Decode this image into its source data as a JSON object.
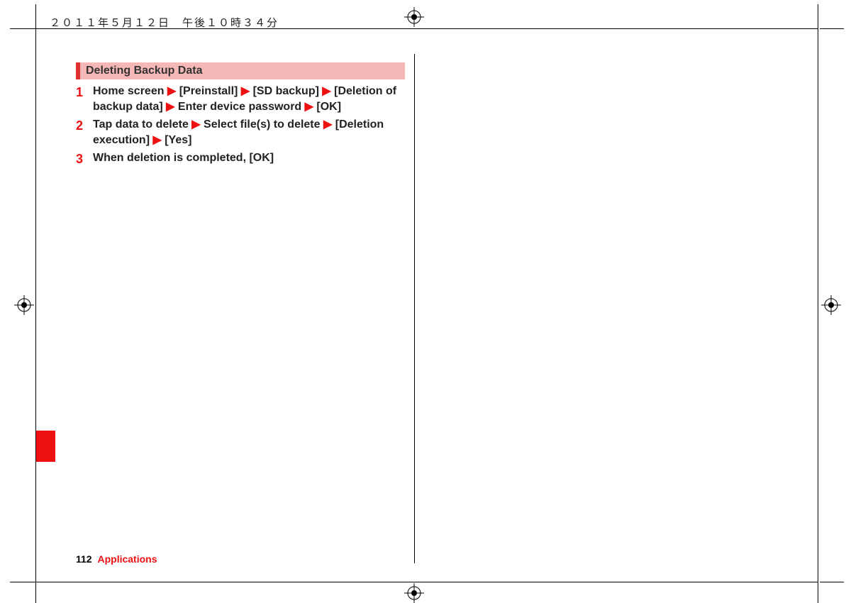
{
  "header": {
    "datetime": "２０１１年５月１２日　午後１０時３４分"
  },
  "section": {
    "title": "Deleting Backup Data"
  },
  "steps": [
    {
      "num": "1",
      "parts": [
        "Home screen ",
        "▶",
        " [Preinstall] ",
        "▶",
        " [SD backup] ",
        "▶",
        " [Deletion of backup data] ",
        "▶",
        " Enter device password ",
        "▶",
        " [OK]"
      ]
    },
    {
      "num": "2",
      "parts": [
        "Tap data to delete ",
        "▶",
        " Select file(s) to delete ",
        "▶",
        " [Deletion execution] ",
        "▶",
        " [Yes]"
      ]
    },
    {
      "num": "3",
      "parts": [
        "When deletion is completed, [OK]"
      ]
    }
  ],
  "footer": {
    "page": "112",
    "section": "Applications"
  }
}
